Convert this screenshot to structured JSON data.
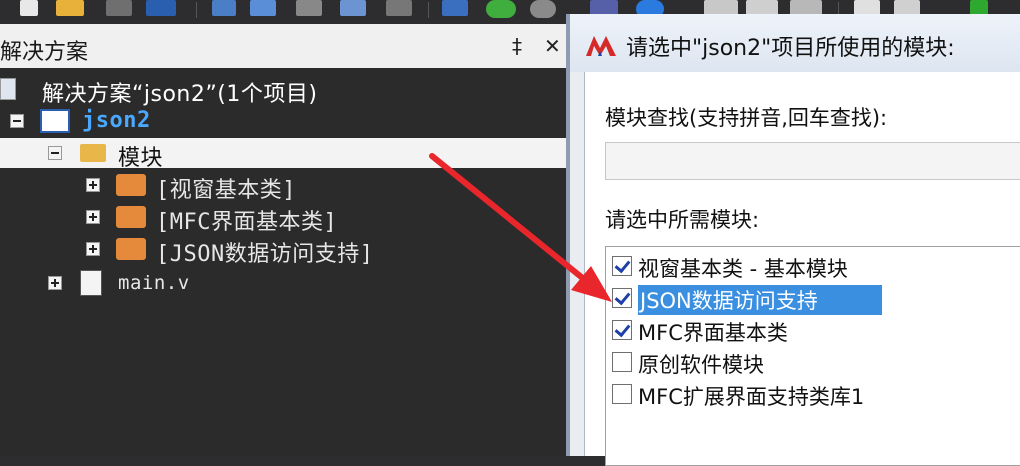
{
  "toolbar": {
    "icons": [
      "new-file-icon",
      "open-folder-icon",
      "save-icon",
      "save-all-icon",
      "stop-icon",
      "navigate-icon",
      "undo-icon",
      "redo-icon",
      "build-icon",
      "go-back-icon",
      "go-forward-icon",
      "module-icon",
      "help-icon",
      "list-icon",
      "grid-icon",
      "table-icon",
      "settings-icon",
      "run-icon"
    ]
  },
  "solution_explorer": {
    "title": "解决方案",
    "pin": "‡",
    "close": "✕",
    "tree": {
      "solution_label": "解决方案“json2”(1个项目)",
      "project_label": "json2",
      "modules_folder": "模块",
      "modules": [
        "[视窗基本类]",
        "[MFC界面基本类]",
        "[JSON数据访问支持]"
      ],
      "file": "main.v"
    }
  },
  "dialog": {
    "title": "请选中\"json2\"项目所使用的模块:",
    "search_label": "模块查找(支持拼音,回车查找):",
    "search_value": "",
    "list_label": "请选中所需模块:",
    "modules": [
      {
        "label": "视窗基本类 - 基本模块",
        "checked": true
      },
      {
        "label": "JSON数据访问支持",
        "checked": true
      },
      {
        "label": "MFC界面基本类",
        "checked": true
      },
      {
        "label": "原创软件模块",
        "checked": false
      },
      {
        "label": "MFC扩展界面支持类库1",
        "checked": false
      }
    ],
    "selected_index": 1
  },
  "colors": {
    "tree_background": "#2b2b2b",
    "selection_blue": "#3b8fe0",
    "project_text": "#4aa8ff",
    "arrow_red": "#e8262b"
  }
}
